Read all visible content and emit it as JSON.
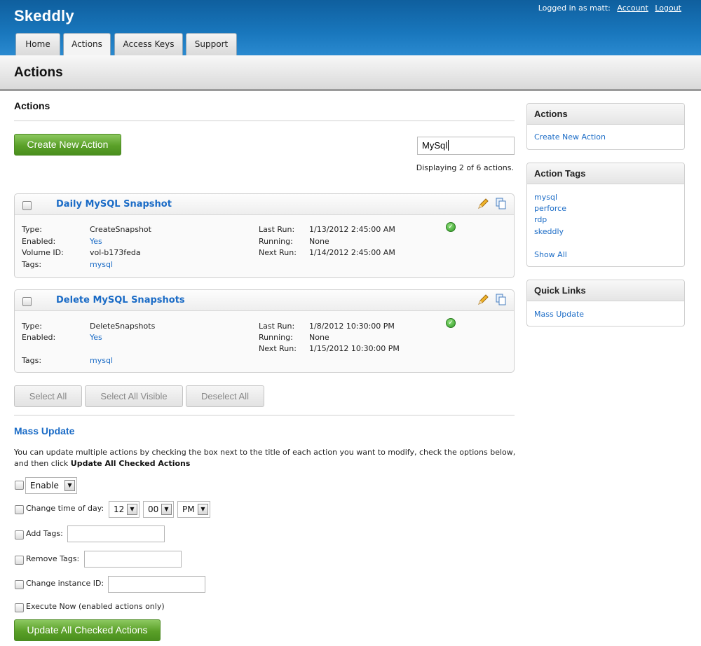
{
  "header": {
    "brand": "Skeddly",
    "logged_in_text": "Logged in as matt:",
    "account_link": "Account",
    "logout_link": "Logout",
    "tabs": [
      {
        "label": "Home"
      },
      {
        "label": "Actions"
      },
      {
        "label": "Access Keys"
      },
      {
        "label": "Support"
      }
    ],
    "active_tab": "Actions"
  },
  "page_title": "Actions",
  "main": {
    "section_title": "Actions",
    "create_button": "Create New Action",
    "search_value": "MySql",
    "displaying": "Displaying 2 of 6 actions.",
    "actions": [
      {
        "title": "Daily MySQL Snapshot",
        "type_label": "Type:",
        "type": "CreateSnapshot",
        "enabled_label": "Enabled:",
        "enabled": "Yes",
        "volume_label": "Volume ID:",
        "volume": "vol-b173feda",
        "tags_label": "Tags:",
        "tags": "mysql",
        "last_run_label": "Last Run:",
        "last_run": "1/13/2012 2:45:00 AM",
        "running_label": "Running:",
        "running": "None",
        "next_run_label": "Next Run:",
        "next_run": "1/14/2012 2:45:00 AM"
      },
      {
        "title": "Delete MySQL Snapshots",
        "type_label": "Type:",
        "type": "DeleteSnapshots",
        "enabled_label": "Enabled:",
        "enabled": "Yes",
        "tags_label": "Tags:",
        "tags": "mysql",
        "last_run_label": "Last Run:",
        "last_run": "1/8/2012 10:30:00 PM",
        "running_label": "Running:",
        "running": "None",
        "next_run_label": "Next Run:",
        "next_run": "1/15/2012 10:30:00 PM"
      }
    ],
    "select_all": "Select All",
    "select_all_visible": "Select All Visible",
    "deselect_all": "Deselect All"
  },
  "mass_update": {
    "title": "Mass Update",
    "description": "You can update multiple actions by checking the box next to the title of each action you want to modify, check the options below, and then click",
    "description_bold": "Update All Checked Actions",
    "enable_option": "Enable",
    "change_time_label": "Change time of day:",
    "hour": "12",
    "minute": "00",
    "ampm": "PM",
    "add_tags_label": "Add Tags:",
    "remove_tags_label": "Remove Tags:",
    "change_instance_label": "Change instance ID:",
    "execute_now_label": "Execute Now (enabled actions only)",
    "update_button": "Update All Checked Actions"
  },
  "sidebar": {
    "actions_box": {
      "title": "Actions",
      "items": [
        "Create New Action"
      ]
    },
    "tags_box": {
      "title": "Action Tags",
      "items": [
        "mysql",
        "perforce",
        "rdp",
        "skeddly"
      ],
      "show_all": "Show All"
    },
    "quick_links_box": {
      "title": "Quick Links",
      "items": [
        "Mass Update"
      ]
    }
  },
  "colors": {
    "link": "#1a6bc6",
    "header_blue": "#1977bd",
    "green_button": "#5aa028"
  }
}
